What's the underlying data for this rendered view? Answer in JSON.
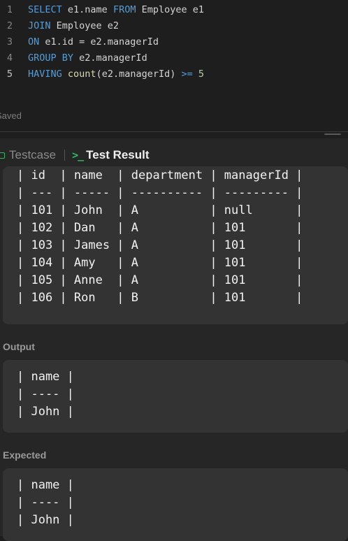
{
  "editor": {
    "lines": [
      {
        "n": "1",
        "parts": [
          {
            "t": "SELECT",
            "c": "kw"
          },
          {
            "t": " e1.name ",
            "c": ""
          },
          {
            "t": "FROM",
            "c": "kw"
          },
          {
            "t": " Employee e1",
            "c": ""
          }
        ]
      },
      {
        "n": "2",
        "parts": [
          {
            "t": "JOIN",
            "c": "kw"
          },
          {
            "t": " Employee e2",
            "c": ""
          }
        ]
      },
      {
        "n": "3",
        "parts": [
          {
            "t": "ON",
            "c": "kw"
          },
          {
            "t": " e1.id = e2.managerId",
            "c": ""
          }
        ]
      },
      {
        "n": "4",
        "parts": [
          {
            "t": "GROUP BY",
            "c": "kw"
          },
          {
            "t": " e2.managerId",
            "c": ""
          }
        ]
      },
      {
        "n": "5",
        "parts": [
          {
            "t": "HAVING",
            "c": "kw"
          },
          {
            "t": " ",
            "c": ""
          },
          {
            "t": "count",
            "c": "fn"
          },
          {
            "t": "(e2.managerId) ",
            "c": ""
          },
          {
            "t": ">=",
            "c": "kw"
          },
          {
            "t": " ",
            "c": ""
          },
          {
            "t": "5",
            "c": "num"
          }
        ]
      }
    ],
    "active_line": "5",
    "status": "Saved"
  },
  "tabs": {
    "testcase": "Testcase",
    "test_result": "Test Result"
  },
  "input_table": [
    "| id  | name  | department | managerId |",
    "| --- | ----- | ---------- | --------- |",
    "| 101 | John  | A          | null      |",
    "| 102 | Dan   | A          | 101       |",
    "| 103 | James | A          | 101       |",
    "| 104 | Amy   | A          | 101       |",
    "| 105 | Anne  | A          | 101       |",
    "| 106 | Ron   | B          | 101       |"
  ],
  "output": {
    "label": "Output",
    "rows": [
      "| name |",
      "| ---- |",
      "| John |"
    ]
  },
  "expected": {
    "label": "Expected",
    "rows": [
      "| name |",
      "| ---- |",
      "| John |"
    ]
  },
  "colors": {
    "keyword": "#569cd6",
    "function": "#dcdcaa",
    "number": "#b5cea8",
    "accent_green": "#2cbb5d"
  }
}
